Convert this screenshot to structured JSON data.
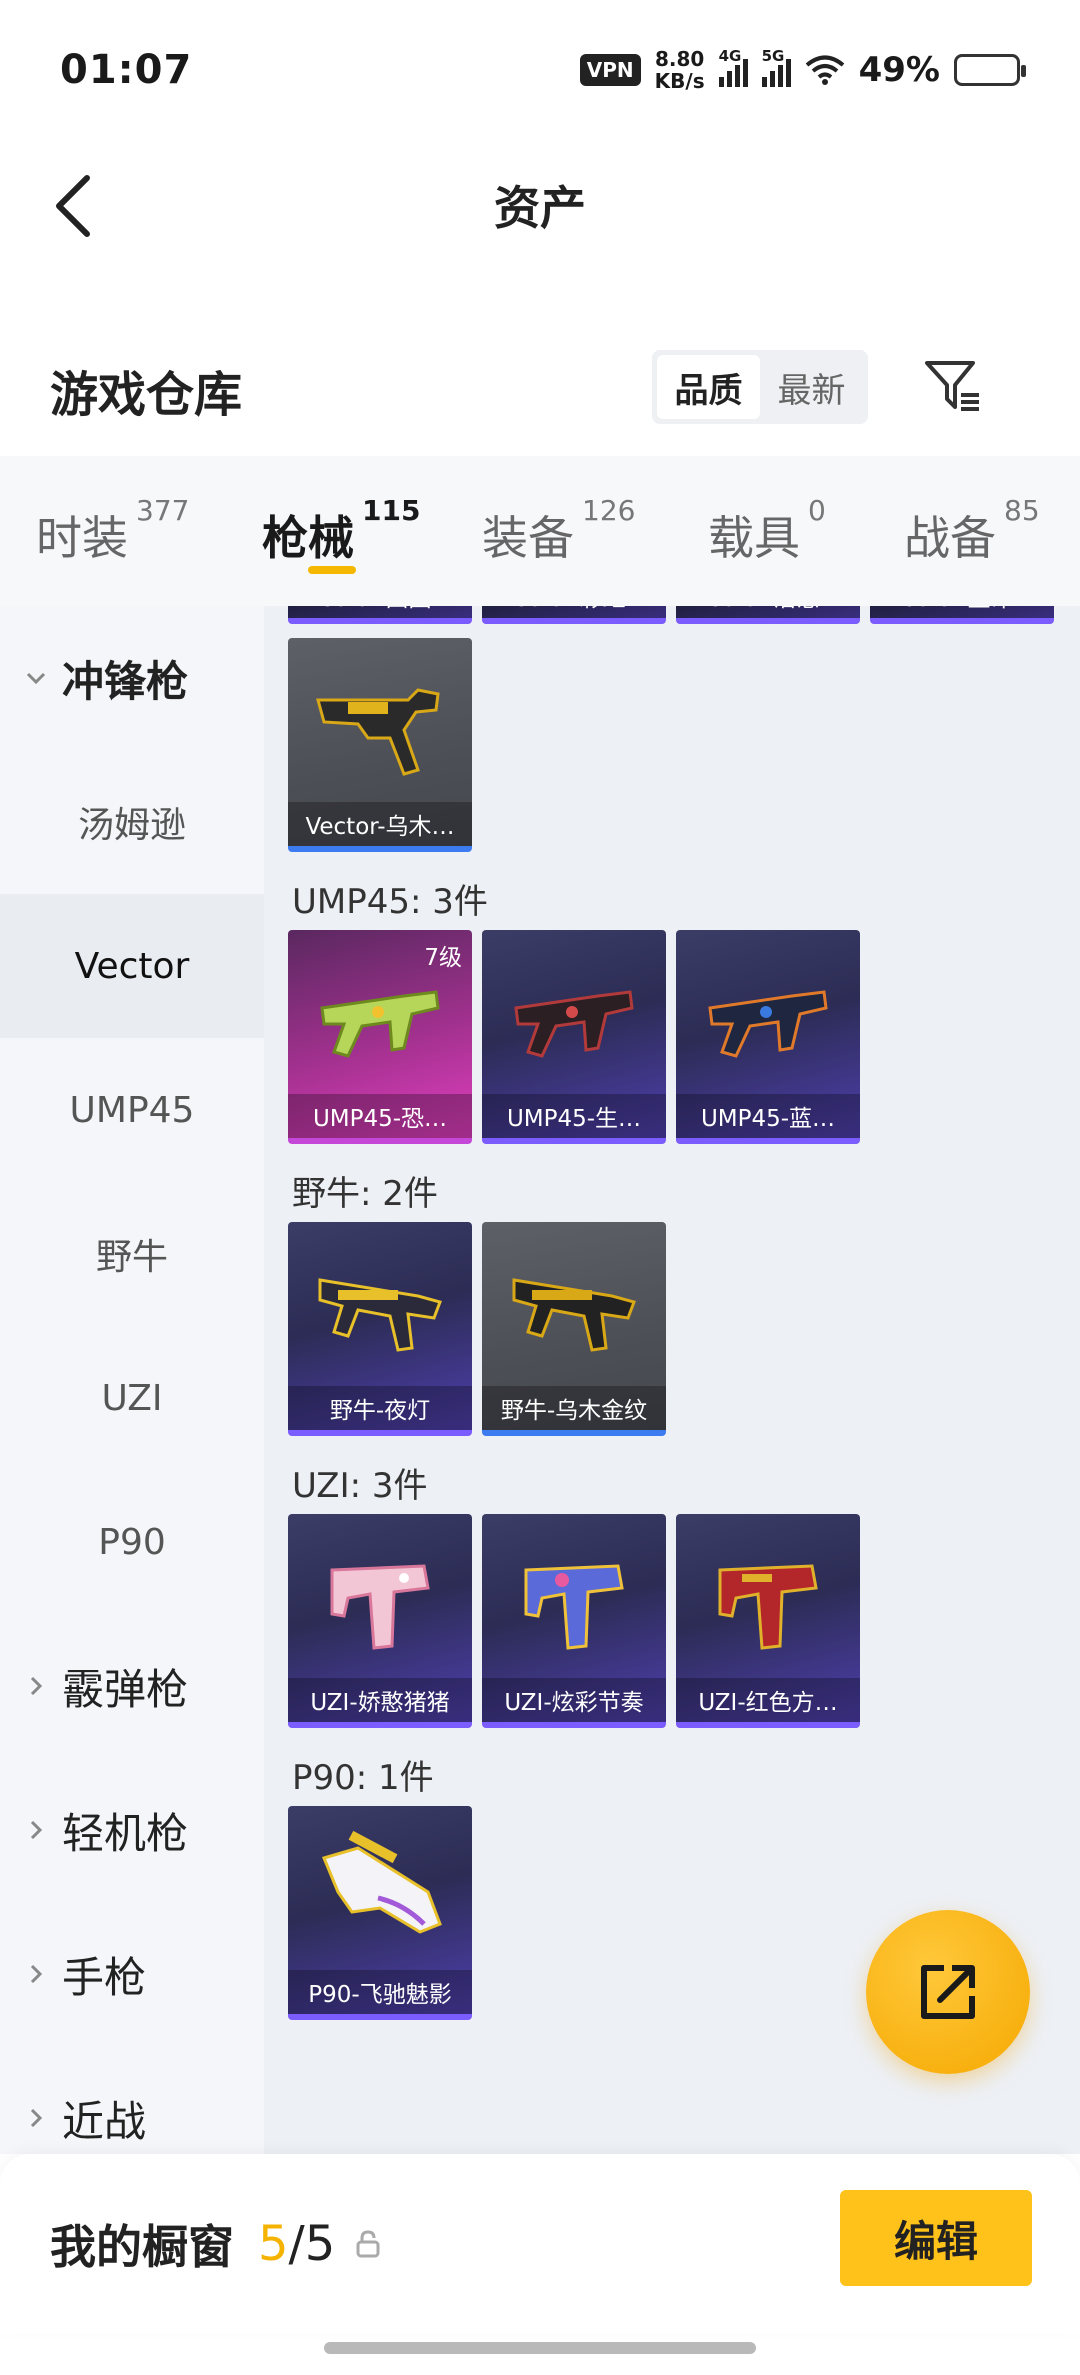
{
  "status_bar": {
    "time": "01:07",
    "vpn": "VPN",
    "speed_value": "8.80",
    "speed_unit": "KB/s",
    "net1": "4G",
    "net2": "5G",
    "battery": "49%"
  },
  "header": {
    "title": "资产"
  },
  "warehouse": {
    "title": "游戏仓库",
    "sort_options": [
      "品质",
      "最新"
    ],
    "sort_selected": "品质"
  },
  "tabs": [
    {
      "label": "时装",
      "count": "377"
    },
    {
      "label": "枪械",
      "count": "115"
    },
    {
      "label": "装备",
      "count": "126"
    },
    {
      "label": "载具",
      "count": "0"
    },
    {
      "label": "战备",
      "count": "85"
    }
  ],
  "active_tab": "枪械",
  "sidebar": {
    "items": [
      {
        "label": "冲锋枪",
        "type": "group",
        "expanded": true
      },
      {
        "label": "汤姆逊",
        "type": "sub"
      },
      {
        "label": "Vector",
        "type": "sub",
        "active": true
      },
      {
        "label": "UMP45",
        "type": "sub"
      },
      {
        "label": "野牛",
        "type": "sub"
      },
      {
        "label": "UZI",
        "type": "sub"
      },
      {
        "label": "P90",
        "type": "sub"
      },
      {
        "label": "霰弹枪",
        "type": "group"
      },
      {
        "label": "轻机枪",
        "type": "group"
      },
      {
        "label": "手枪",
        "type": "group"
      },
      {
        "label": "近战",
        "type": "group"
      }
    ]
  },
  "content": {
    "vector_partial_row": [
      "Vector-田园…",
      "Vector-彩虹…",
      "Vector-治愈…",
      "Vector-生命…"
    ],
    "vector_extra": "Vector-乌木…",
    "sections": [
      {
        "title": "UMP45: 3件",
        "items": [
          {
            "name": "UMP45-恐…",
            "level": "7级",
            "style": "pink"
          },
          {
            "name": "UMP45-生…",
            "style": "purple"
          },
          {
            "name": "UMP45-蓝…",
            "style": "purple"
          }
        ]
      },
      {
        "title": "野牛: 2件",
        "items": [
          {
            "name": "野牛-夜灯",
            "style": "purple"
          },
          {
            "name": "野牛-乌木金纹",
            "style": "gray"
          }
        ]
      },
      {
        "title": "UZI: 3件",
        "items": [
          {
            "name": "UZI-娇憨猪猪",
            "style": "purple"
          },
          {
            "name": "UZI-炫彩节奏",
            "style": "purple"
          },
          {
            "name": "UZI-红色方…",
            "style": "purple"
          }
        ]
      },
      {
        "title": "P90: 1件",
        "items": [
          {
            "name": "P90-飞驰魅影",
            "style": "purple"
          }
        ]
      }
    ]
  },
  "bottom_bar": {
    "label": "我的橱窗",
    "count_current": "5",
    "count_sep": "/",
    "count_total": "5",
    "edit_label": "编辑"
  },
  "colors": {
    "accent": "#ffc21a",
    "tab_underline": "#f5b800",
    "card_purple": "#3b3d66",
    "card_pink": "#e13fc0",
    "card_gray": "#5e6067"
  },
  "icons": [
    "back-arrow-icon",
    "filter-icon",
    "chevron-down-icon",
    "chevron-right-icon",
    "share-external-icon",
    "lock-icon",
    "wifi-icon",
    "battery-icon"
  ]
}
